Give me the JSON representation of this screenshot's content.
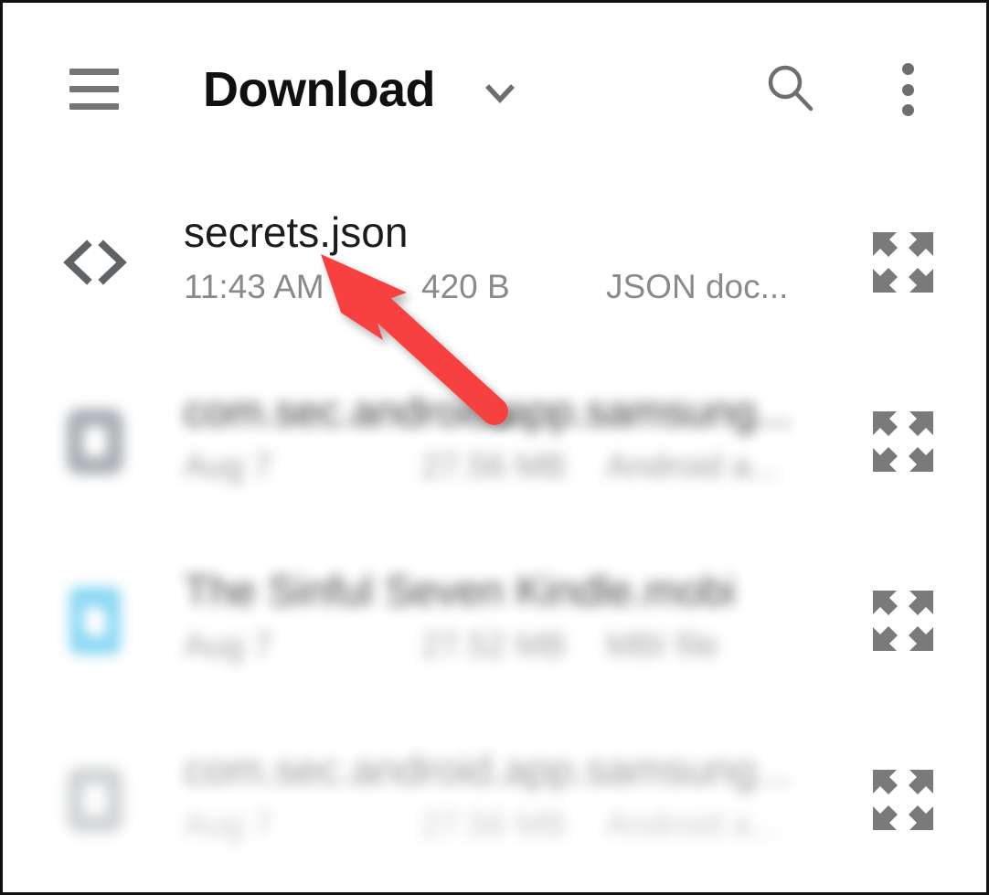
{
  "appbar": {
    "title": "Download",
    "menu_icon": "hamburger-icon",
    "dropdown_icon": "chevron-down-icon",
    "search_icon": "search-icon",
    "overflow_icon": "more-vertical-icon"
  },
  "list": {
    "expand_icon": "expand-arrows-icon",
    "rows": [
      {
        "name": "secrets.json",
        "date": "11:43 AM",
        "size": "420 B",
        "kind": "JSON doc...",
        "icon": "code-file-icon",
        "blur": ""
      },
      {
        "name": "com.sec.android.app.samsung...",
        "date": "Aug 7",
        "size": "27.56 MB",
        "kind": "Android a...",
        "icon": "apk-package-icon",
        "blur": "blur-1"
      },
      {
        "name": "The Sinful Seven Kindle.mobi",
        "date": "Aug 7",
        "size": "27.52 MB",
        "kind": "MBI file",
        "icon": "ebook-doc-icon",
        "blur": "blur-2"
      },
      {
        "name": "com.sec.android.app.samsung...",
        "date": "Aug 7",
        "size": "27.56 MB",
        "kind": "Android a...",
        "icon": "apk-package-icon",
        "blur": "blur-3"
      }
    ]
  },
  "annotation": {
    "type": "arrow",
    "color": "#f7403f",
    "points_to": "secrets.json"
  },
  "colors": {
    "background": "#ffffff",
    "title_text": "#101010",
    "meta_text": "#8a8a8a",
    "icon_gray": "#6e6e6e",
    "accent_red": "#f7403f",
    "doc_blue": "#6fcff0"
  }
}
